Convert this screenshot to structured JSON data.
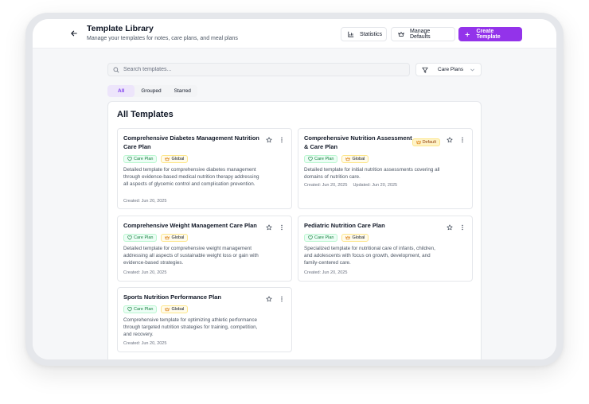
{
  "header": {
    "title": "Template Library",
    "subtitle": "Manage your templates for notes, care plans, and meal plans",
    "statistics_label": "Statistics",
    "manage_defaults_label": "Manage Defaults",
    "create_label": "Create Template"
  },
  "search": {
    "placeholder": "Search templates..."
  },
  "filter": {
    "selected": "Care Plans"
  },
  "tabs": [
    "All",
    "Grouped",
    "Starred"
  ],
  "section_title": "All Templates",
  "cards": [
    {
      "title": "Comprehensive Diabetes Management Nutrition Care Plan",
      "type_badge": "Care Plan",
      "scope_badge": "Global",
      "description": "Detailed template for comprehensive diabetes management through evidence-based medical nutrition therapy addressing all aspects of glycemic control and complication prevention.",
      "created": "Created: Jun 20, 2025"
    },
    {
      "title": "Comprehensive Nutrition Assessment & Care Plan",
      "default_badge": "Default",
      "type_badge": "Care Plan",
      "scope_badge": "Global",
      "description": "Detailed template for initial nutrition assessments covering all domains of nutrition care.",
      "created": "Created: Jun 20, 2025",
      "updated": "Updated: Jun 20, 2025"
    },
    {
      "title": "Comprehensive Weight Management Care Plan",
      "type_badge": "Care Plan",
      "scope_badge": "Global",
      "description": "Detailed template for comprehensive weight management addressing all aspects of sustainable weight loss or gain with evidence-based strategies.",
      "created": "Created: Jun 20, 2025"
    },
    {
      "title": "Pediatric Nutrition Care Plan",
      "type_badge": "Care Plan",
      "scope_badge": "Global",
      "description": "Specialized template for nutritional care of infants, children, and adolescents with focus on growth, development, and family-centered care.",
      "created": "Created: Jun 20, 2025"
    },
    {
      "title": "Sports Nutrition Performance Plan",
      "type_badge": "Care Plan",
      "scope_badge": "Global",
      "description": "Comprehensive template for optimizing athletic performance through targeted nutrition strategies for training, competition, and recovery.",
      "created": "Created: Jun 20, 2025"
    }
  ],
  "colors": {
    "accent": "#9333ea",
    "care_plan": "#15803d",
    "global": "#d97706"
  }
}
